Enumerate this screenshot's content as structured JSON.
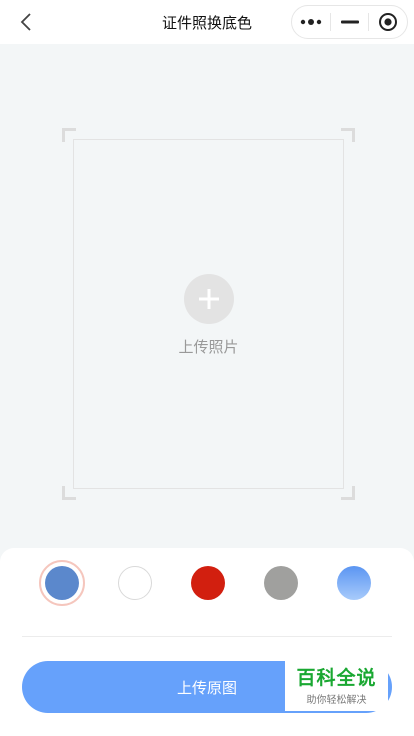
{
  "header": {
    "title": "证件照换底色",
    "back_icon": "chevron-left-icon",
    "more_icon": "more-dots-icon",
    "minimize_icon": "minimize-icon",
    "close_icon": "target-close-icon"
  },
  "frame": {
    "upload_label": "上传照片",
    "plus_icon": "plus-icon"
  },
  "colors": [
    {
      "name": "blue",
      "hex": "#5b88cc",
      "selected": true
    },
    {
      "name": "white",
      "hex": "#ffffff",
      "selected": false
    },
    {
      "name": "red",
      "hex": "#d21f0f",
      "selected": false
    },
    {
      "name": "gray",
      "hex": "#a0a09e",
      "selected": false
    },
    {
      "name": "gradient-blue",
      "hex": "#6ca1f5",
      "selected": false
    }
  ],
  "actions": {
    "upload_original_label": "上传原图"
  },
  "watermark": {
    "title": "百科全说",
    "subtitle": "助你轻松解决"
  }
}
